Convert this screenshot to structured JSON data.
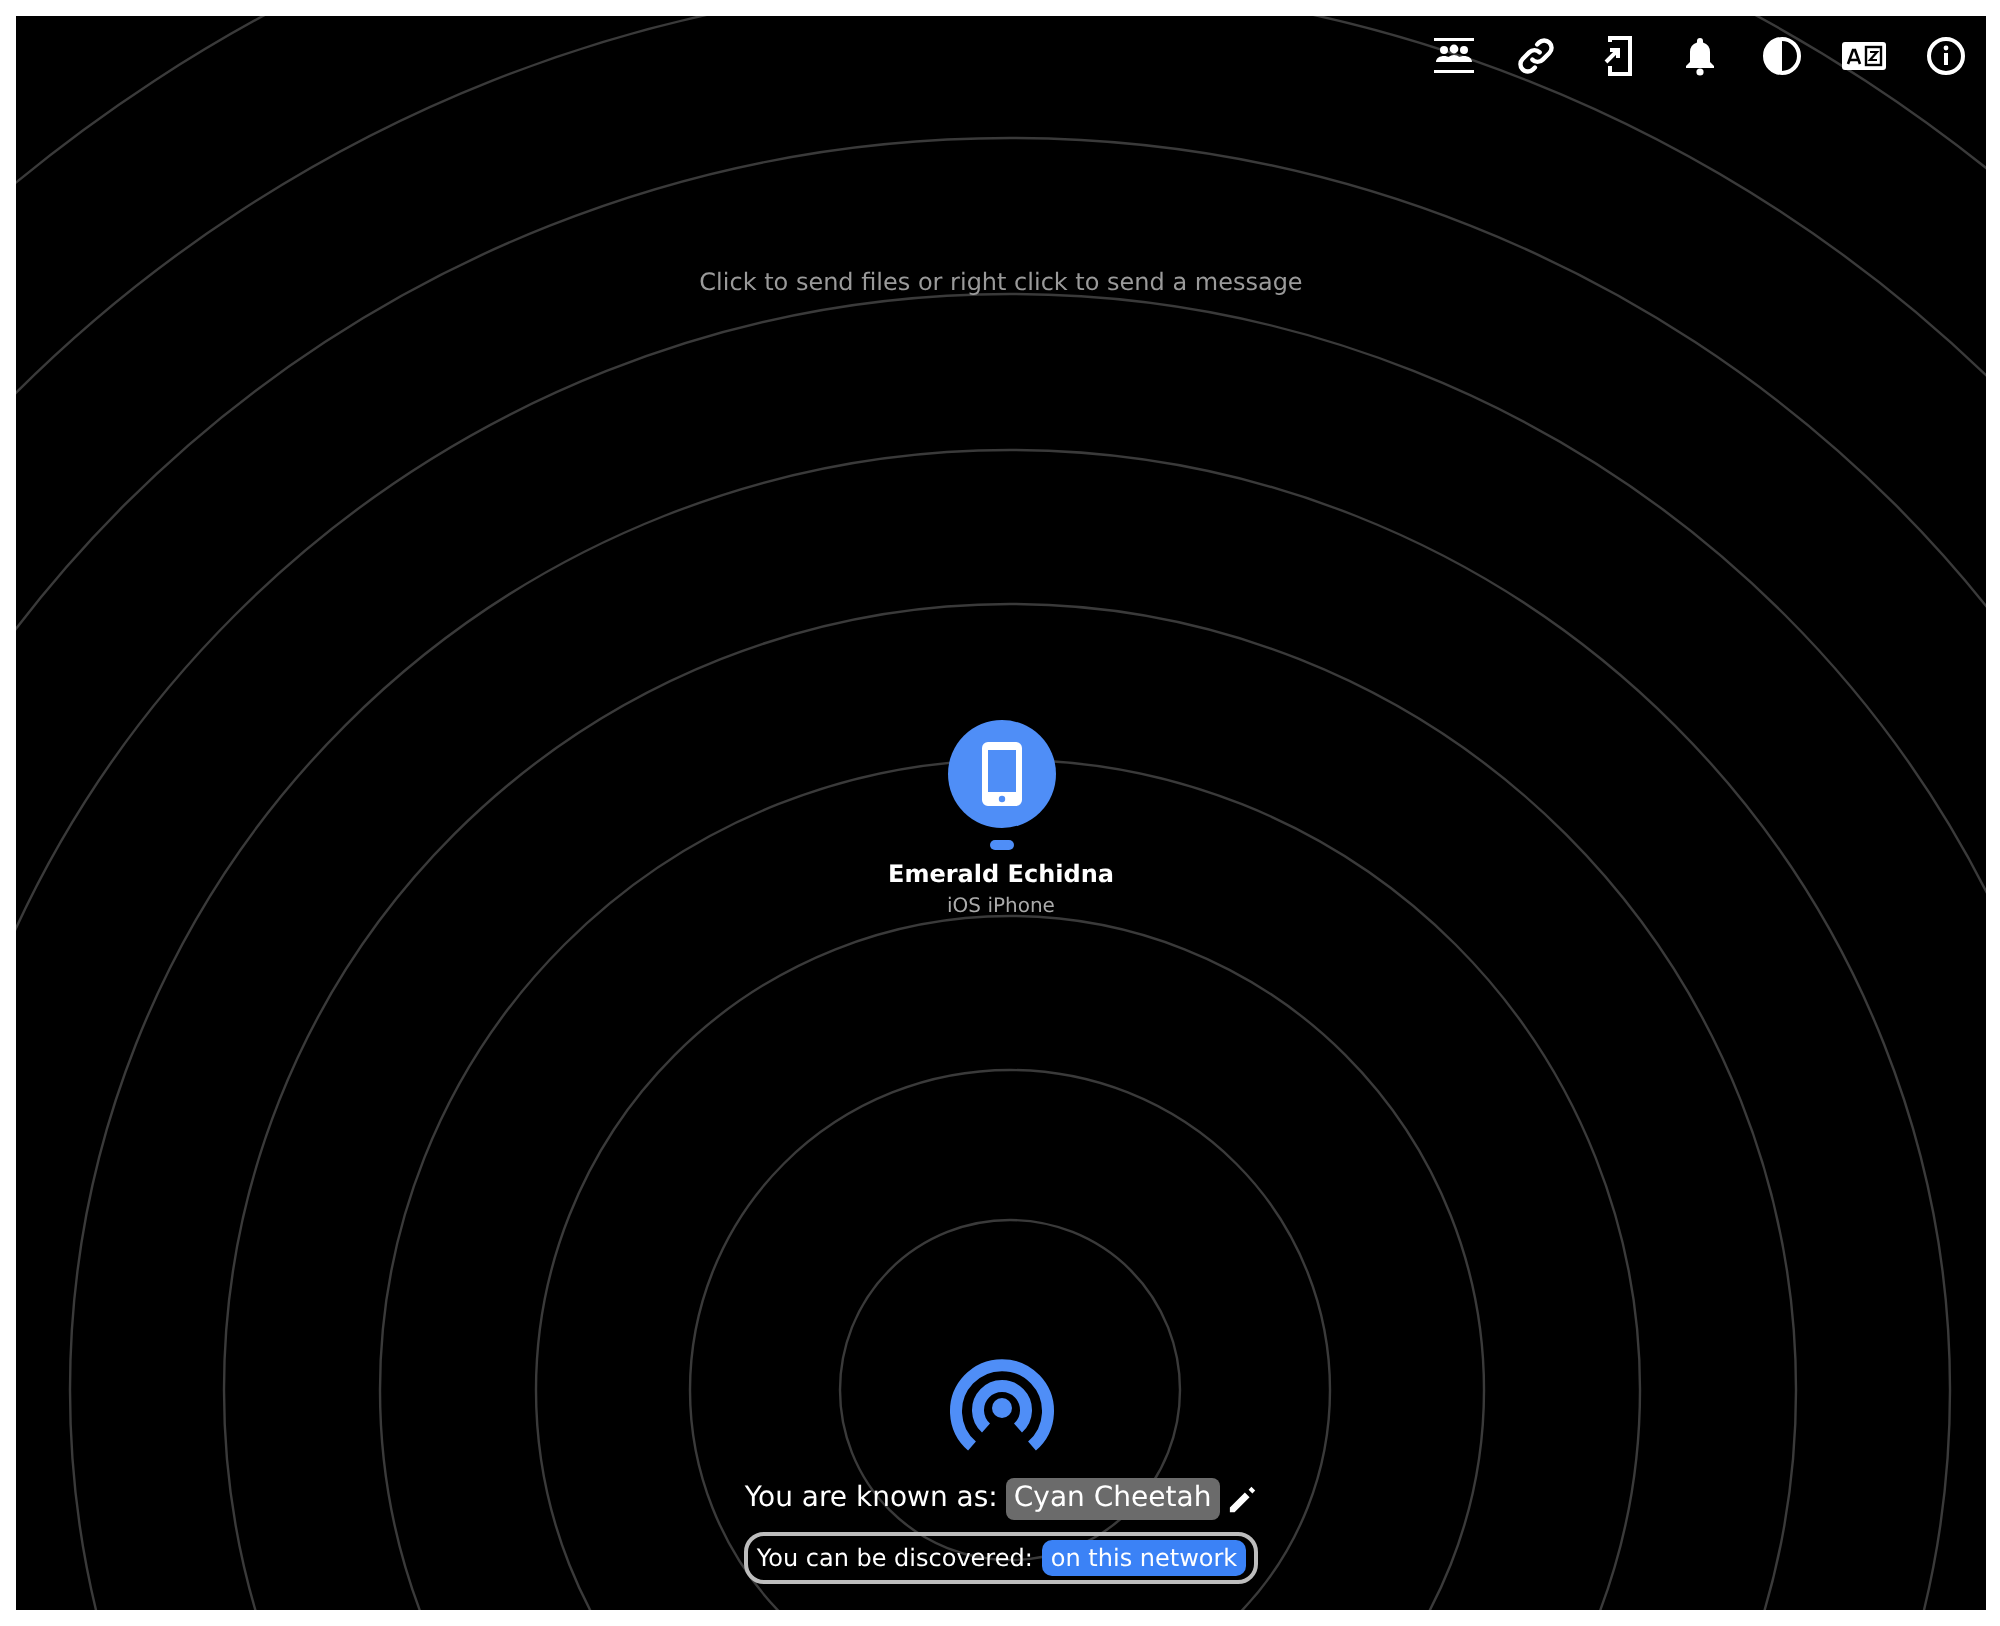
{
  "hint": "Click to send files or right click to send a message",
  "peers": [
    {
      "name": "Emerald Echidna",
      "device": "iOS iPhone"
    }
  ],
  "self": {
    "label": "You are known as:",
    "name": "Cyan Cheetah"
  },
  "discovery": {
    "label": "You can be discovered:",
    "value": "on this network"
  }
}
